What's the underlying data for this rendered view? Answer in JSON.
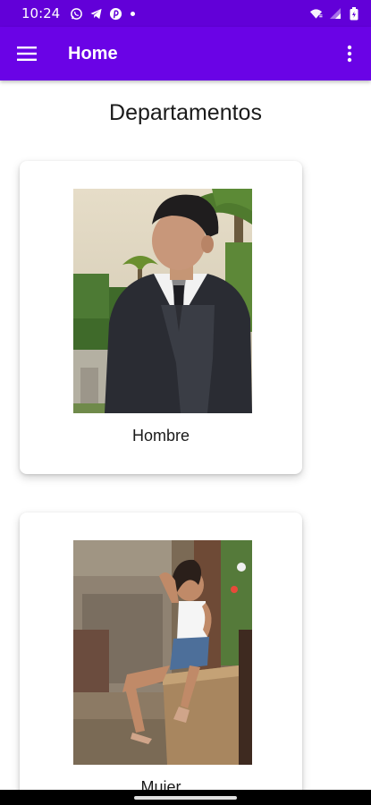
{
  "status_bar": {
    "time": "10:24",
    "left_icons": [
      "whatsapp-icon",
      "telegram-icon",
      "pinterest-icon",
      "notification-dot-icon"
    ],
    "right_icons": [
      "wifi-icon",
      "signal-icon",
      "battery-icon"
    ]
  },
  "app_bar": {
    "title": "Home",
    "menu_icon": "hamburger-menu-icon",
    "more_icon": "more-vertical-icon"
  },
  "main": {
    "heading": "Departamentos",
    "cards": [
      {
        "label": "Hombre"
      },
      {
        "label": "Mujer"
      }
    ]
  },
  "colors": {
    "status_bar": "#6200d8",
    "app_bar": "#6a03e6",
    "text": "#1a1a1a"
  }
}
